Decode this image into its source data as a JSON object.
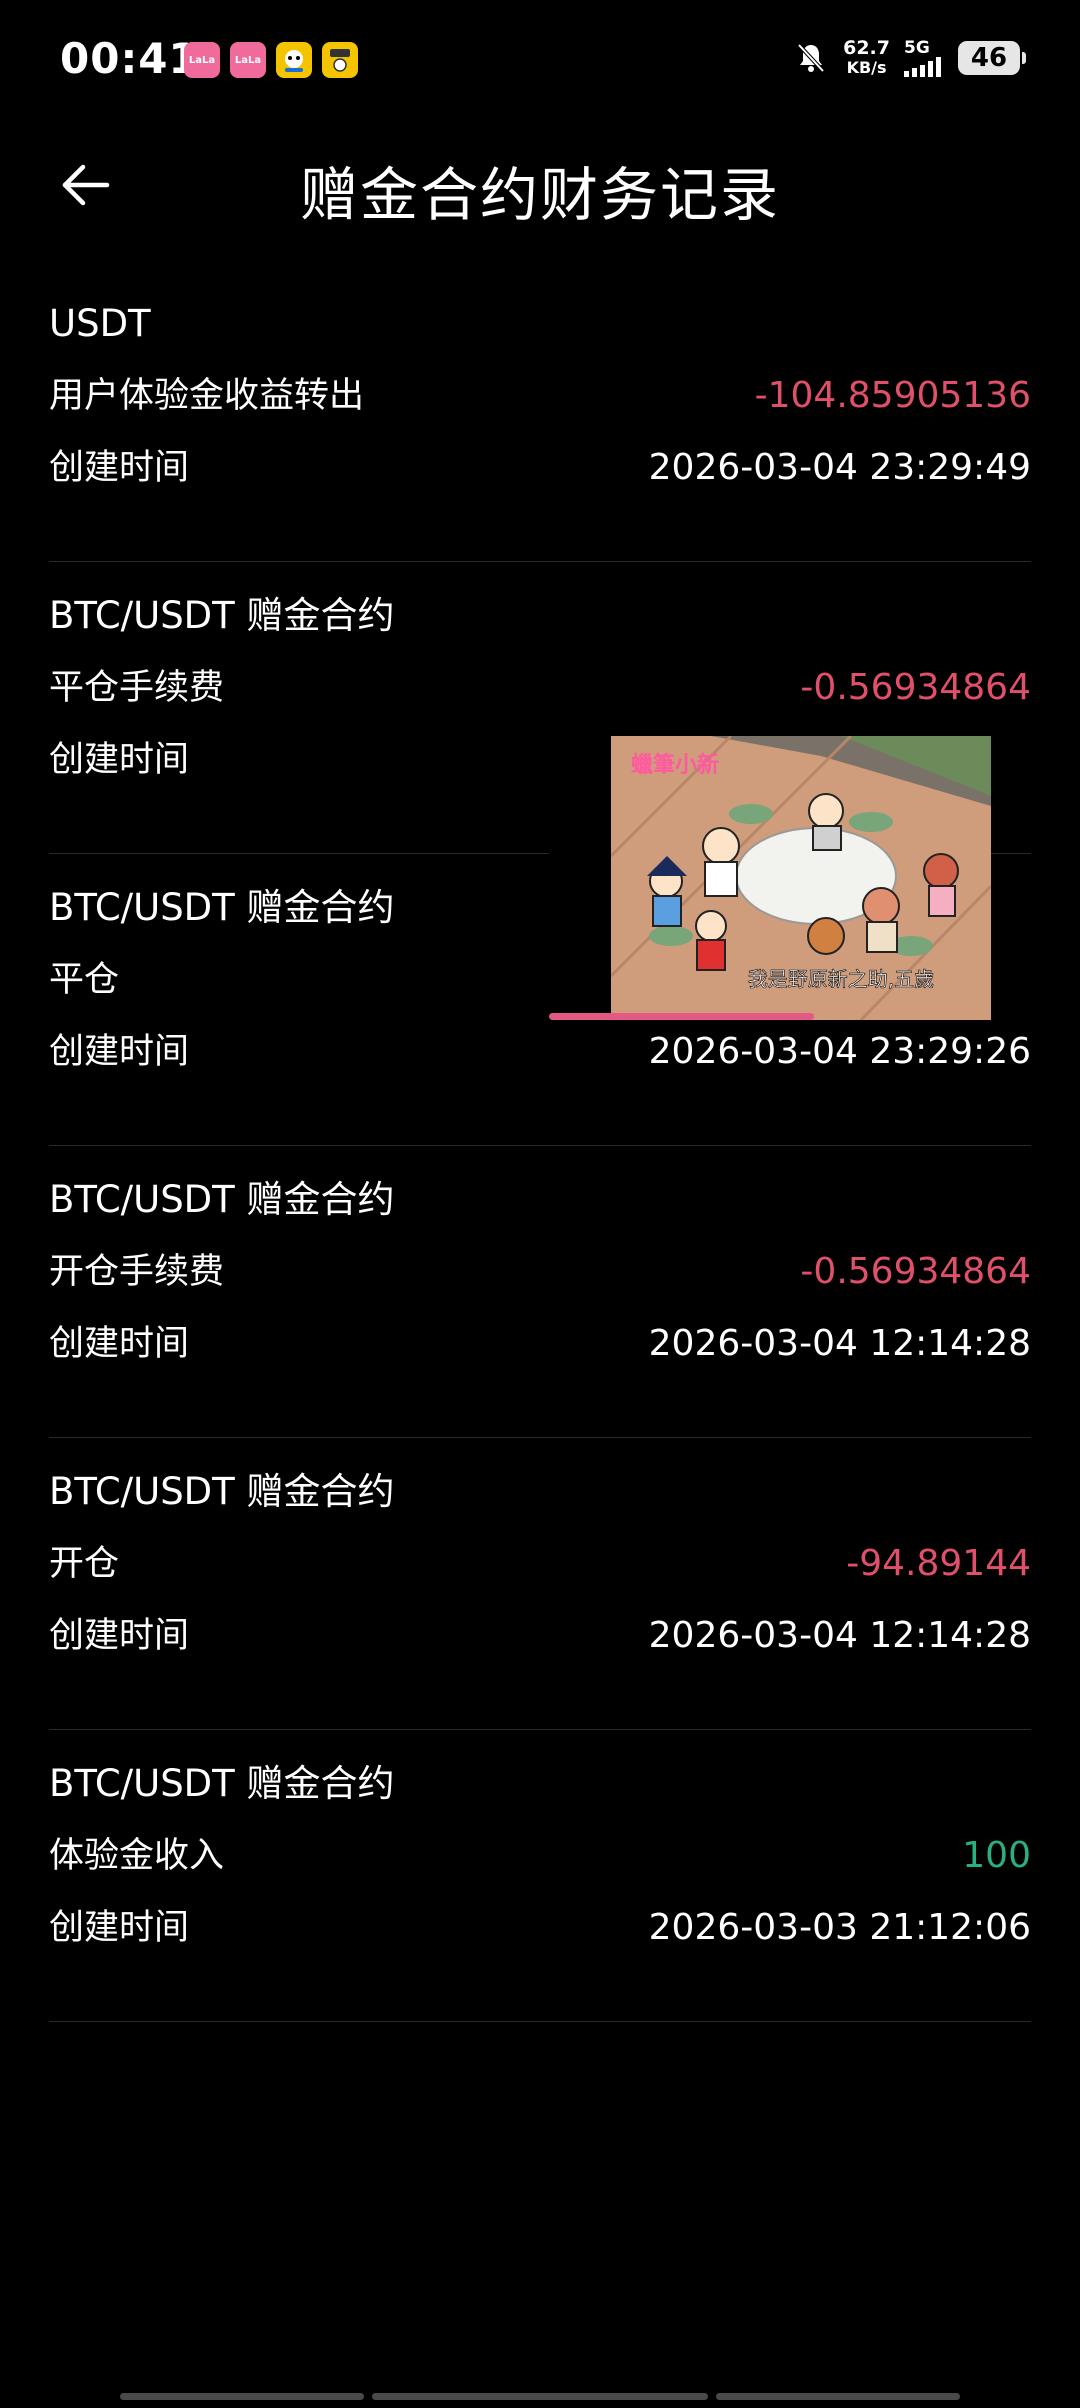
{
  "status_bar": {
    "time": "00:41",
    "apps": [
      {
        "name": "lala-app-1",
        "label": "LaLa",
        "color": "#f06a9b"
      },
      {
        "name": "lala-app-2",
        "label": "LaLa",
        "color": "#f06a9b"
      },
      {
        "name": "yellow-app-1",
        "label": "",
        "color": "#f5c400"
      },
      {
        "name": "yellow-app-2",
        "label": "",
        "color": "#f5c400"
      }
    ],
    "net_speed": "62.7",
    "net_speed_unit": "KB/s",
    "network_type": "5G",
    "battery": "46",
    "icons": [
      "bell-muted-icon",
      "signal-icon",
      "battery-icon"
    ]
  },
  "header": {
    "back_icon": "arrow-left-icon",
    "title": "赠金合约财务记录"
  },
  "records": [
    {
      "title": "USDT",
      "type": "用户体验金收益转出",
      "amount": "-104.85905136",
      "amount_sign": "negative",
      "time_label": "创建时间",
      "time": "2026-03-04 23:29:49"
    },
    {
      "title": "BTC/USDT 赠金合约",
      "type": "平仓手续费",
      "amount": "-0.56934864",
      "amount_sign": "negative",
      "time_label": "创建时间",
      "time": ""
    },
    {
      "title": "BTC/USDT 赠金合约",
      "type": "平仓",
      "amount": "",
      "amount_sign": "negative",
      "time_label": "创建时间",
      "time": "2026-03-04 23:29:26"
    },
    {
      "title": "BTC/USDT 赠金合约",
      "type": "开仓手续费",
      "amount": "-0.56934864",
      "amount_sign": "negative",
      "time_label": "创建时间",
      "time": "2026-03-04 12:14:28"
    },
    {
      "title": "BTC/USDT 赠金合约",
      "type": "开仓",
      "amount": "-94.89144",
      "amount_sign": "negative",
      "time_label": "创建时间",
      "time": "2026-03-04 12:14:28"
    },
    {
      "title": "BTC/USDT 赠金合约",
      "type": "体验金收入",
      "amount": "100",
      "amount_sign": "positive",
      "time_label": "创建时间",
      "time": "2026-03-03 21:12:06"
    }
  ],
  "video_overlay": {
    "subtitle": "我是野原新之助,五歲",
    "logo_text": "蠟筆小新",
    "progress": 0.6
  },
  "colors": {
    "background": "#000000",
    "negative": "#e0506a",
    "positive": "#28b17f",
    "divider": "#2a2a2a"
  }
}
